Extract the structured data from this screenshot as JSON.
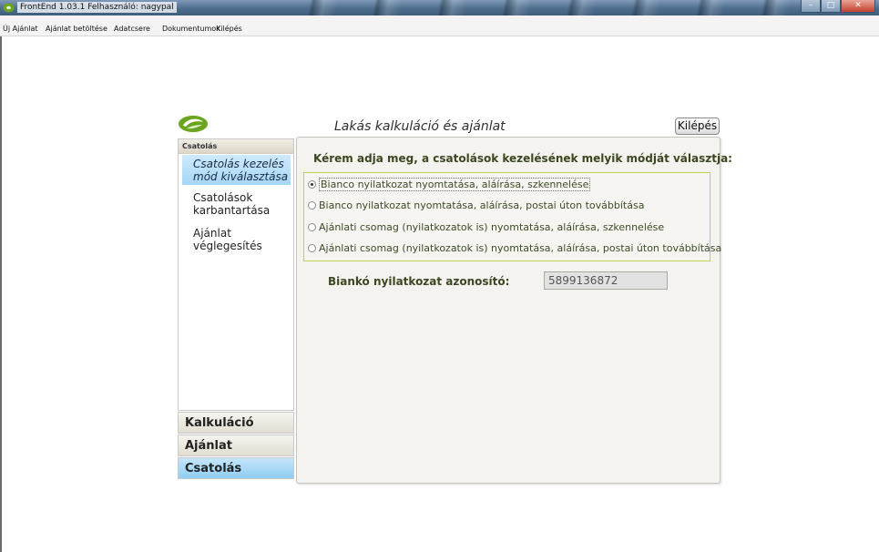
{
  "window": {
    "title": "FrontEnd 1.03.1  Felhasználó: nagypal",
    "controls": {
      "minimize": "–",
      "maximize": "□",
      "close": "✕"
    }
  },
  "menu": {
    "items": [
      "Új Ajánlat",
      "Ajánlat betöltése",
      "Adatcsere",
      "Dokumentumok",
      "Kilépés"
    ]
  },
  "header": {
    "title": "Lakás kalkuláció és ajánlat",
    "exit_label": "Kilépés"
  },
  "sidebar": {
    "section_title": "Csatolás",
    "items": [
      {
        "label": "Csatolás kezelés mód kiválasztása",
        "active": true
      },
      {
        "label": "Csatolások karbantartása",
        "active": false
      },
      {
        "label": "Ajánlat véglegesítés",
        "active": false
      }
    ],
    "groups": [
      "Kalkuláció",
      "Ajánlat",
      "Csatolás"
    ],
    "active_group": "Csatolás"
  },
  "main": {
    "question": "Kérem adja meg, a csatolások kezelésének melyik módját választja:",
    "options": [
      "Bianco nyilatkozat nyomtatása, aláírása, szkennelése",
      "Bianco nyilatkozat nyomtatása, aláírása, postai úton továbbítása",
      "Ajánlati csomag (nyilatkozatok is) nyomtatása, aláírása, szkennelése",
      "Ajánlati csomag (nyilatkozatok is) nyomtatása, aláírása, postai úton továbbítása"
    ],
    "selected_option": 0,
    "field_label": "Biankó nyilatkozat azonosító:",
    "field_value": "5899136872"
  },
  "colors": {
    "accent_green": "#c3d04f",
    "active_blue": "#a5d6f6",
    "text_olive": "#3c4621"
  }
}
